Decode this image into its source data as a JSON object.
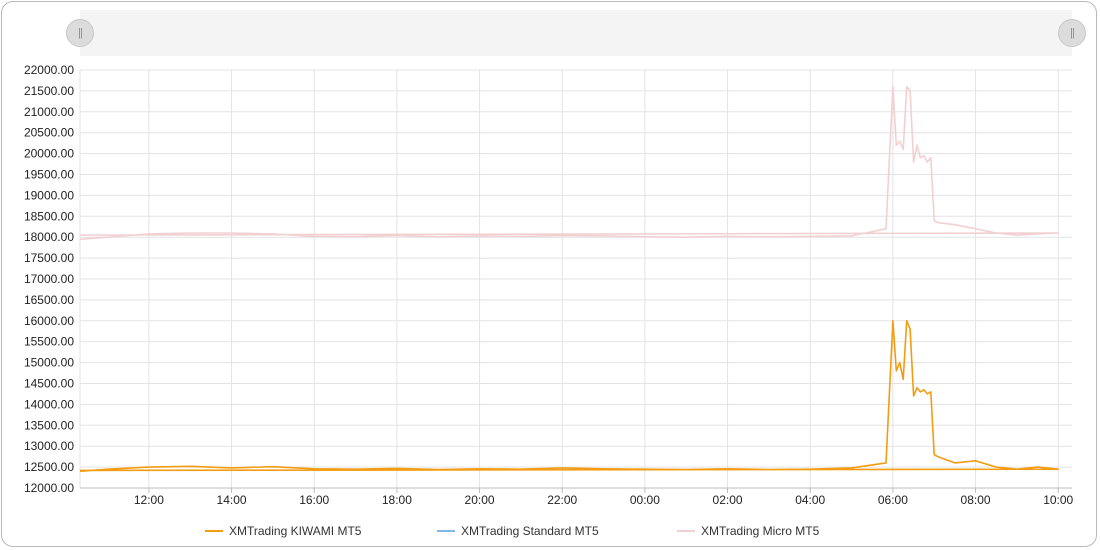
{
  "controls": {
    "left_handle_glyph": "||",
    "right_handle_glyph": "||"
  },
  "chart_data": {
    "type": "line",
    "ylim": [
      12000,
      22000
    ],
    "y_ticks": [
      "22000.00",
      "21500.00",
      "21000.00",
      "20500.00",
      "20000.00",
      "19500.00",
      "19000.00",
      "18500.00",
      "18000.00",
      "17500.00",
      "17000.00",
      "16500.00",
      "16000.00",
      "15500.00",
      "15000.00",
      "14500.00",
      "14000.00",
      "13500.00",
      "13000.00",
      "12500.00",
      "12000.00"
    ],
    "x_ticks": [
      "12:00",
      "14:00",
      "16:00",
      "18:00",
      "20:00",
      "22:00",
      "00:00",
      "02:00",
      "04:00",
      "06:00",
      "08:00",
      "10:00"
    ],
    "grid": true,
    "legend_placement": "bottom",
    "series": [
      {
        "name": "XMTrading KIWAMI MT5",
        "color": "#f39c12",
        "x": [
          "10:20",
          "11:00",
          "12:00",
          "13:00",
          "14:00",
          "15:00",
          "16:00",
          "17:00",
          "18:00",
          "19:00",
          "20:00",
          "21:00",
          "22:00",
          "23:00",
          "00:00",
          "01:00",
          "02:00",
          "03:00",
          "04:00",
          "05:00",
          "05:50",
          "06:00",
          "06:05",
          "06:10",
          "06:15",
          "06:20",
          "06:25",
          "06:30",
          "06:35",
          "06:40",
          "06:45",
          "06:50",
          "06:55",
          "07:00",
          "07:05",
          "07:30",
          "08:00",
          "08:30",
          "09:00",
          "09:30",
          "10:00",
          "10:20"
        ],
        "y": [
          12400,
          12450,
          12500,
          12520,
          12480,
          12510,
          12460,
          12450,
          12470,
          12440,
          12460,
          12450,
          12480,
          12460,
          12450,
          12440,
          12460,
          12440,
          12450,
          12480,
          12600,
          16000,
          14800,
          15000,
          14600,
          16000,
          15800,
          14200,
          14400,
          14300,
          14350,
          14250,
          14300,
          12800,
          12750,
          12600,
          12650,
          12500,
          12450,
          12500,
          12450,
          12420
        ]
      },
      {
        "name": "XMTrading Standard MT5",
        "color": "#7fb8e6",
        "x": [],
        "y": []
      },
      {
        "name": "XMTrading Micro MT5",
        "color": "#f2d0d2",
        "x": [
          "10:20",
          "11:00",
          "12:00",
          "13:00",
          "14:00",
          "15:00",
          "16:00",
          "17:00",
          "18:00",
          "19:00",
          "20:00",
          "21:00",
          "22:00",
          "23:00",
          "00:00",
          "01:00",
          "02:00",
          "03:00",
          "04:00",
          "05:00",
          "05:50",
          "06:00",
          "06:05",
          "06:10",
          "06:15",
          "06:20",
          "06:25",
          "06:30",
          "06:35",
          "06:40",
          "06:45",
          "06:50",
          "06:55",
          "07:00",
          "07:05",
          "07:30",
          "08:00",
          "08:30",
          "09:00",
          "09:30",
          "10:00",
          "10:20"
        ],
        "y": [
          17950,
          18000,
          18080,
          18100,
          18100,
          18080,
          18020,
          18010,
          18040,
          18010,
          18030,
          18020,
          18040,
          18030,
          18010,
          18000,
          18020,
          18010,
          18020,
          18030,
          18200,
          21600,
          20200,
          20300,
          20100,
          21600,
          21500,
          19800,
          20200,
          19900,
          19950,
          19800,
          19900,
          18400,
          18350,
          18300,
          18200,
          18100,
          18050,
          18080,
          18100,
          18050
        ]
      }
    ]
  }
}
